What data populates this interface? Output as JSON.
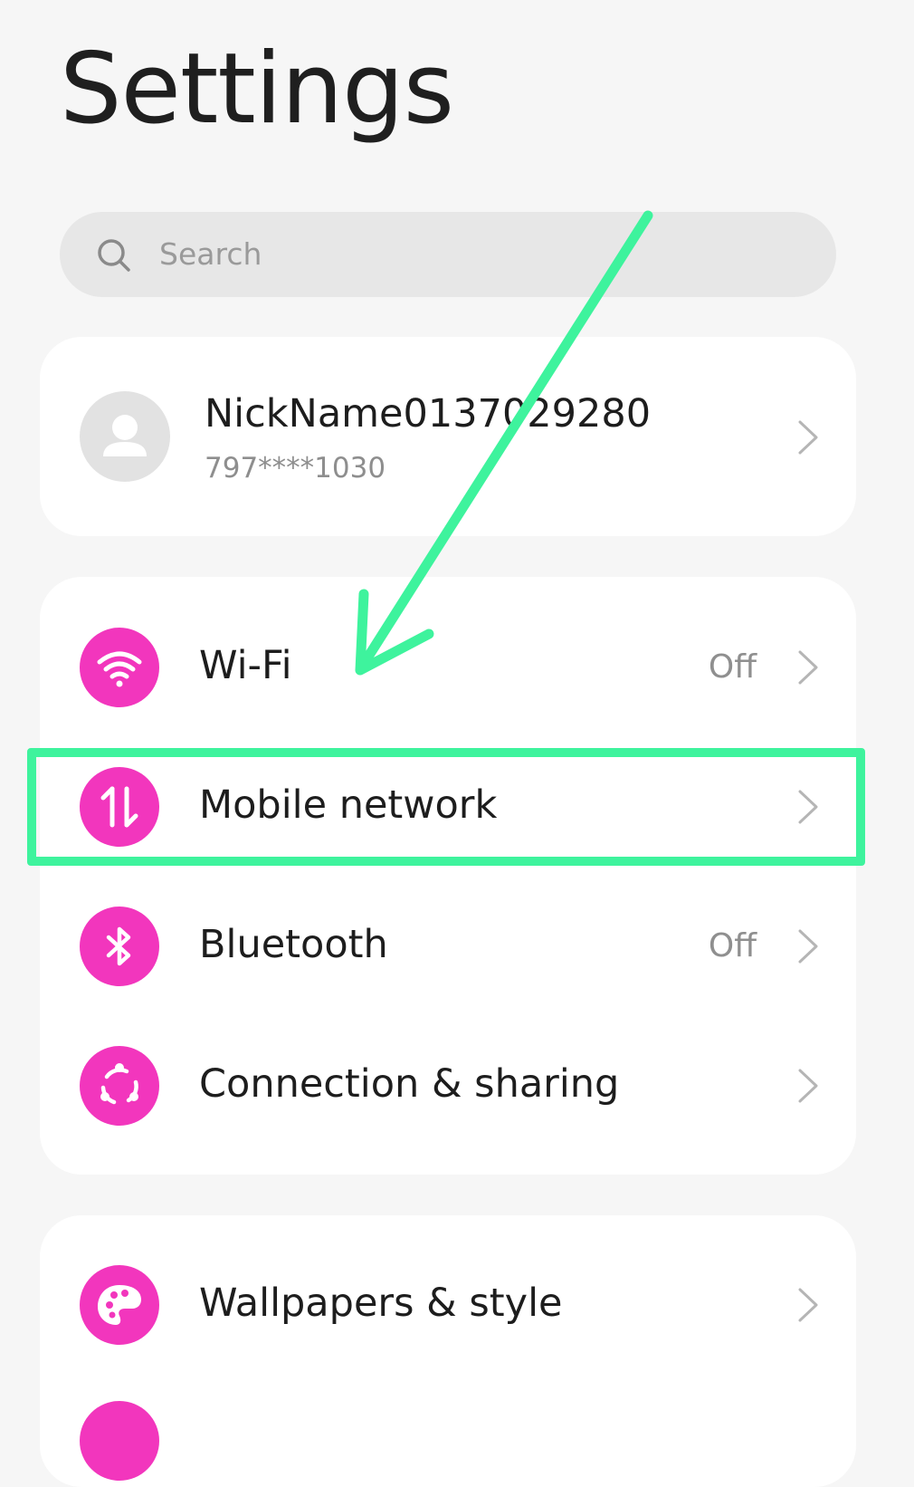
{
  "header": {
    "title": "Settings"
  },
  "search": {
    "placeholder": "Search"
  },
  "account": {
    "name": "NickName0137029280",
    "phone": "797****1030"
  },
  "connectivity": {
    "items": [
      {
        "label": "Wi-Fi",
        "status": "Off",
        "icon": "wifi-icon"
      },
      {
        "label": "Mobile network",
        "status": "",
        "icon": "mobile-data-icon"
      },
      {
        "label": "Bluetooth",
        "status": "Off",
        "icon": "bluetooth-icon"
      },
      {
        "label": "Connection & sharing",
        "status": "",
        "icon": "connection-sharing-icon"
      }
    ]
  },
  "personal": {
    "items": [
      {
        "label": "Wallpapers & style",
        "status": "",
        "icon": "palette-icon"
      }
    ]
  },
  "colors": {
    "icon_bg": "#f236bd",
    "annotation": "#3ef39d",
    "background": "#f6f6f6"
  }
}
